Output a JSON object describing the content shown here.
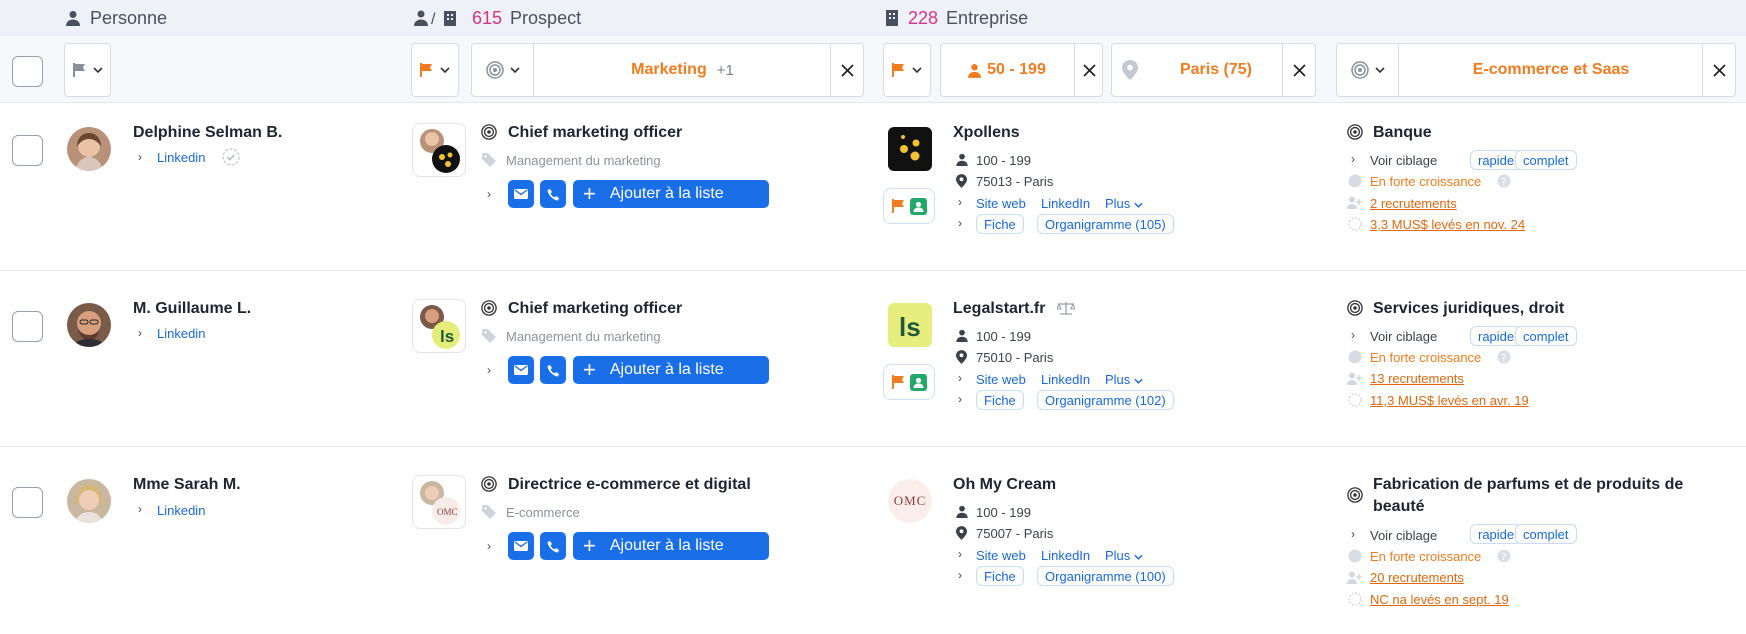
{
  "header": {
    "personne": {
      "label": "Personne"
    },
    "prospect": {
      "count": "615",
      "label": "Prospect"
    },
    "entreprise": {
      "count": "228",
      "label": "Entreprise"
    }
  },
  "filters": {
    "function_value": "Marketing",
    "function_extra": "+1",
    "size_value": "50 - 199",
    "location_value": "Paris (75)",
    "sector_value": "E-commerce et Saas"
  },
  "colors": {
    "accent": "#1a6fe8",
    "orange": "#f07c1e",
    "pink": "#d63384"
  },
  "rows": [
    {
      "person": {
        "name": "Delphine Selman B.",
        "linkedin": "Linkedin",
        "verified": true
      },
      "prospect": {
        "title": "Chief marketing officer",
        "department": "Management du marketing",
        "add_label": "Ajouter à la liste"
      },
      "company": {
        "name": "Xpollens",
        "size": "100 - 199",
        "address": "75013 - Paris",
        "site": "Site web",
        "linkedin": "LinkedIn",
        "plus": "Plus",
        "fiche": "Fiche",
        "organigram": "Organigramme (105)"
      },
      "sector": {
        "name": "Banque",
        "voir": "Voir ciblage",
        "rapide": "rapide",
        "complet": "complet",
        "growth": "En forte croissance",
        "recruit": "2 recrutements",
        "funding": "3,3 MUS$ levés en nov. 24"
      }
    },
    {
      "person": {
        "name": "M. Guillaume L.",
        "linkedin": "Linkedin",
        "verified": false
      },
      "prospect": {
        "title": "Chief marketing officer",
        "department": "Management du marketing",
        "add_label": "Ajouter à la liste"
      },
      "company": {
        "name": "Legalstart.fr",
        "size": "100 - 199",
        "address": "75010 - Paris",
        "site": "Site web",
        "linkedin": "LinkedIn",
        "plus": "Plus",
        "fiche": "Fiche",
        "organigram": "Organigramme (102)"
      },
      "sector": {
        "name": "Services juridiques, droit",
        "voir": "Voir ciblage",
        "rapide": "rapide",
        "complet": "complet",
        "growth": "En forte croissance",
        "recruit": "13 recrutements",
        "funding": "11,3 MUS$ levés en avr. 19"
      }
    },
    {
      "person": {
        "name": "Mme Sarah M.",
        "linkedin": "Linkedin",
        "verified": false
      },
      "prospect": {
        "title": "Directrice e-commerce et digital",
        "department": "E-commerce",
        "add_label": "Ajouter à la liste"
      },
      "company": {
        "name": "Oh My Cream",
        "size": "100 - 199",
        "address": "75007 - Paris",
        "site": "Site web",
        "linkedin": "LinkedIn",
        "plus": "Plus",
        "fiche": "Fiche",
        "organigram": "Organigramme (100)",
        "logo_text": "OMC"
      },
      "sector": {
        "name_line1": "Fabrication de parfums et de produits de",
        "name_line2": "beauté",
        "voir": "Voir ciblage",
        "rapide": "rapide",
        "complet": "complet",
        "growth": "En forte croissance",
        "recruit": "20 recrutements",
        "funding": "NC na levés en sept. 19"
      }
    }
  ]
}
